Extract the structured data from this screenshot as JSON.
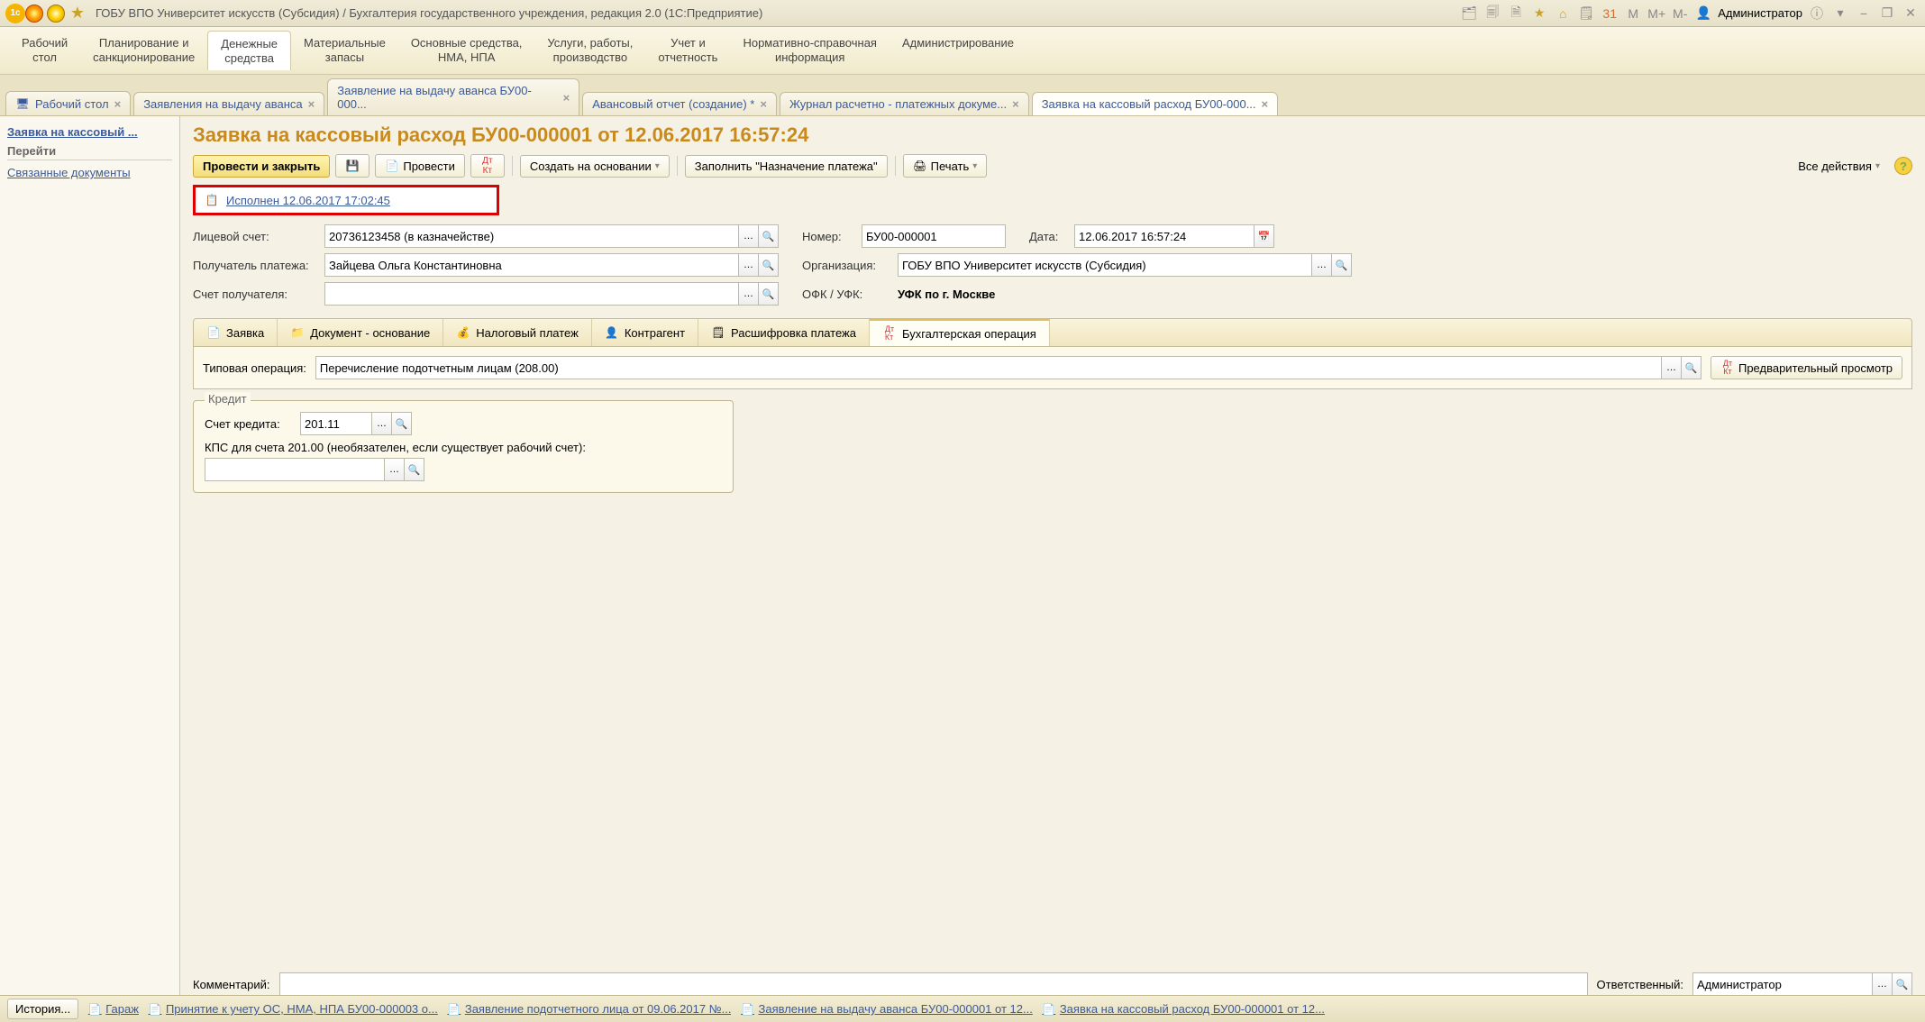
{
  "titlebar": {
    "title": "ГОБУ ВПО Университет искусств (Субсидия) / Бухгалтерия государственного учреждения, редакция 2.0  (1С:Предприятие)",
    "user_label": "Администратор",
    "m_labels": [
      "M",
      "M+",
      "M-"
    ]
  },
  "mainmenu": [
    "Рабочий\nстол",
    "Планирование и\nсанкционирование",
    "Денежные\nсредства",
    "Материальные\nзапасы",
    "Основные средства,\nНМА, НПА",
    "Услуги, работы,\nпроизводство",
    "Учет и\nотчетность",
    "Нормативно-справочная\nинформация",
    "Администрирование"
  ],
  "tabs": [
    {
      "label": "Рабочий стол",
      "closable": true,
      "icon": "desk"
    },
    {
      "label": "Заявления на выдачу аванса",
      "closable": true
    },
    {
      "label": "Заявление на выдачу аванса БУ00-000...",
      "closable": true
    },
    {
      "label": "Авансовый отчет (создание) *",
      "closable": true
    },
    {
      "label": "Журнал расчетно - платежных докуме...",
      "closable": true
    },
    {
      "label": "Заявка на кассовый расход БУ00-000...",
      "closable": true,
      "active": true
    }
  ],
  "sidebar": {
    "title": "Заявка на кассовый ...",
    "group": "Перейти",
    "links": [
      "Связанные документы"
    ]
  },
  "page": {
    "title": "Заявка на кассовый расход БУ00-000001 от 12.06.2017 16:57:24",
    "toolbar": {
      "post_close": "Провести и закрыть",
      "post": "Провести",
      "create_based": "Создать на основании",
      "fill_purpose": "Заполнить \"Назначение платежа\"",
      "print": "Печать",
      "all_actions": "Все действия"
    },
    "status": "Исполнен 12.06.2017 17:02:45",
    "fields": {
      "account_label": "Лицевой счет:",
      "account_value": "20736123458 (в казначействе)",
      "number_label": "Номер:",
      "number_value": "БУ00-000001",
      "date_label": "Дата:",
      "date_value": "12.06.2017 16:57:24",
      "payee_label": "Получатель платежа:",
      "payee_value": "Зайцева Ольга Константиновна",
      "org_label": "Организация:",
      "org_value": "ГОБУ ВПО Университет искусств (Субсидия)",
      "payee_acc_label": "Счет получателя:",
      "payee_acc_value": "",
      "ofk_label": "ОФК / УФК:",
      "ofk_value": "УФК по г. Москве"
    },
    "subtabs": [
      "Заявка",
      "Документ - основание",
      "Налоговый платеж",
      "Контрагент",
      "Расшифровка платежа",
      "Бухгалтерская операция"
    ],
    "op": {
      "label": "Типовая операция:",
      "value": "Перечисление подотчетным лицам (208.00)",
      "preview": "Предварительный просмотр"
    },
    "credit": {
      "legend": "Кредит",
      "acc_label": "Счет кредита:",
      "acc_value": "201.11",
      "kps_label": "КПС для счета 201.00 (необязателен, если существует рабочий счет):",
      "kps_value": ""
    },
    "footer": {
      "comment_label": "Комментарий:",
      "comment_value": "",
      "resp_label": "Ответственный:",
      "resp_value": "Администратор"
    }
  },
  "taskbar": {
    "history": "История...",
    "items": [
      "Гараж",
      "Принятие к учету ОС, НМА, НПА БУ00-000003 о...",
      "Заявление подотчетного лица от 09.06.2017 №...",
      "Заявление на выдачу аванса БУ00-000001 от 12...",
      "Заявка на кассовый расход БУ00-000001 от 12..."
    ]
  }
}
